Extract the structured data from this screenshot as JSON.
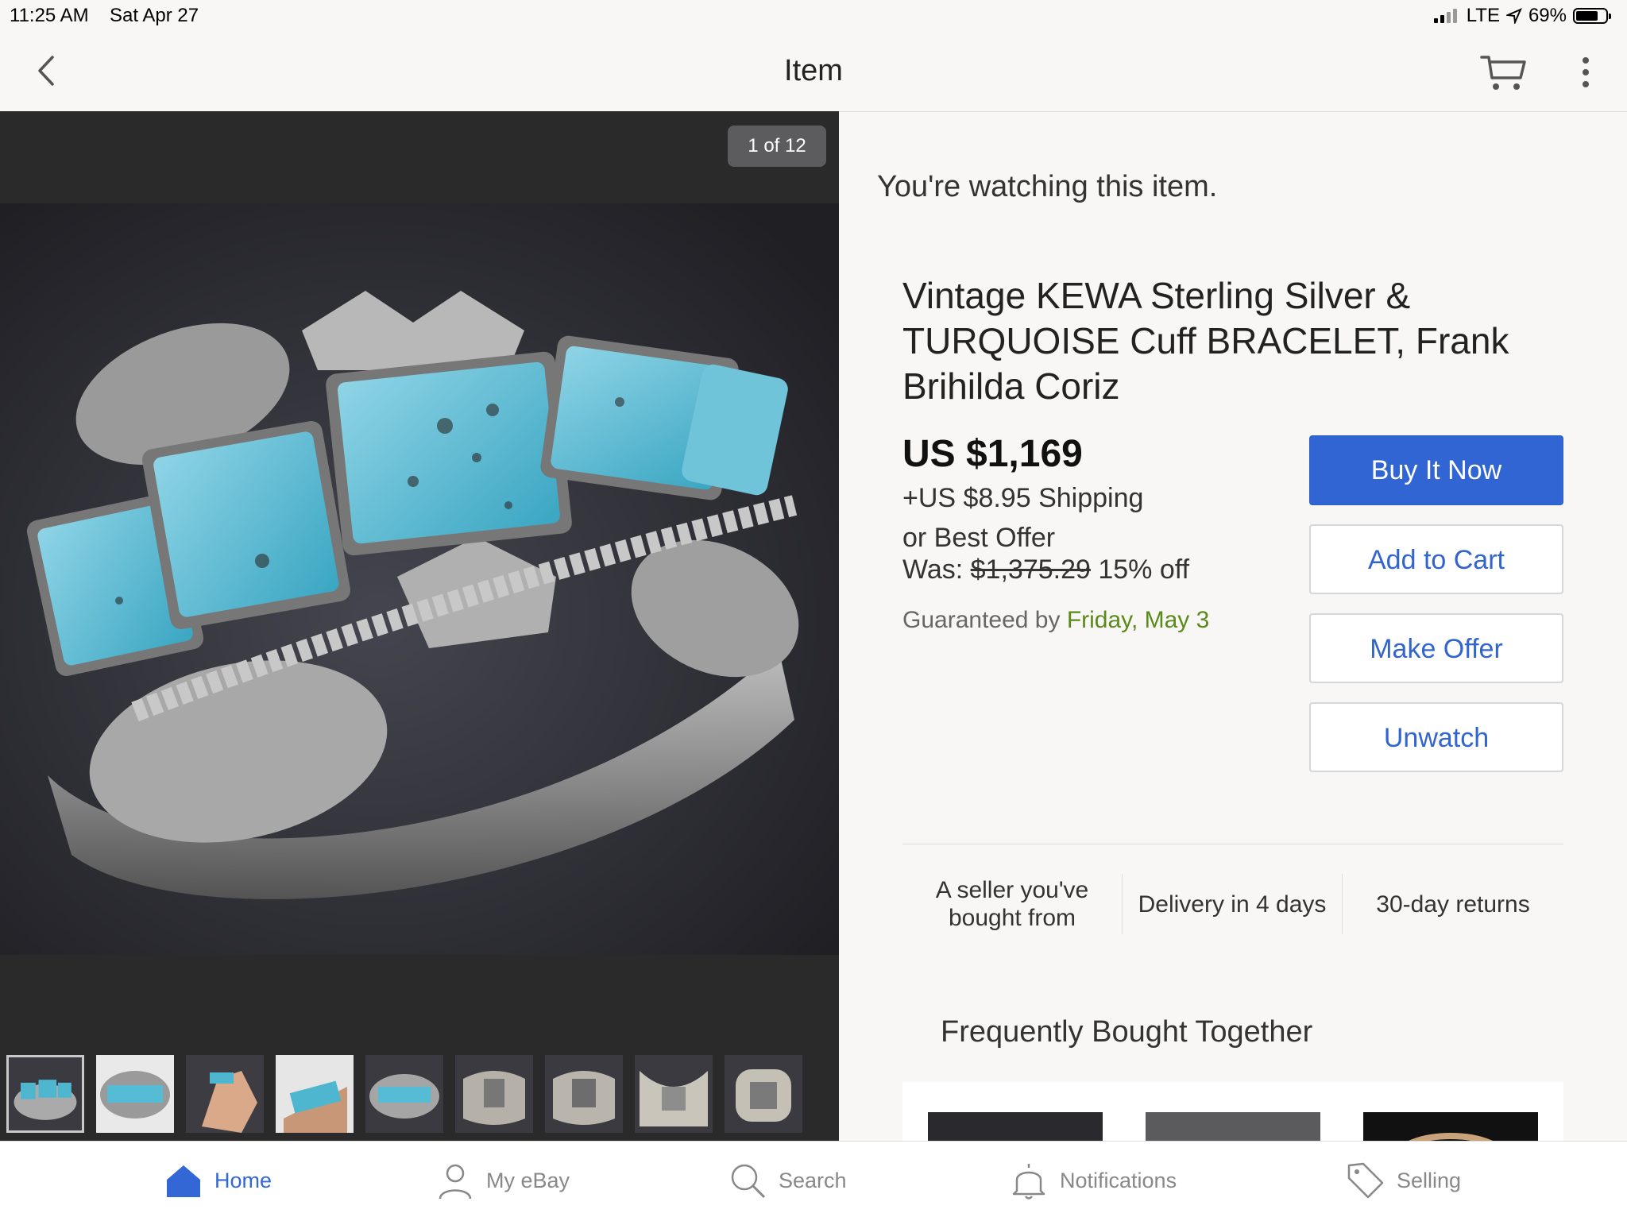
{
  "status_bar": {
    "time": "11:25 AM",
    "date": "Sat Apr 27",
    "network": "LTE",
    "battery": "69%"
  },
  "nav": {
    "title": "Item"
  },
  "gallery": {
    "counter": "1 of 12",
    "thumbnail_count": 9,
    "selected_index": 0
  },
  "item": {
    "watching_text": "You're watching this item.",
    "title": "Vintage KEWA Sterling Silver & TURQUOISE Cuff BRACELET, Frank Brihilda Coriz",
    "price": "US $1,169",
    "shipping": "+US $8.95 Shipping",
    "best_offer": "or Best Offer",
    "was_label": "Was:",
    "was_price": "$1,375.29",
    "discount": "15% off",
    "guaranteed_label": "Guaranteed by",
    "guaranteed_date": "Friday, May 3"
  },
  "actions": {
    "buy_now": "Buy It Now",
    "add_to_cart": "Add to Cart",
    "make_offer": "Make Offer",
    "unwatch": "Unwatch"
  },
  "features": {
    "seller": "A seller you've bought from",
    "delivery": "Delivery in 4 days",
    "returns": "30-day returns"
  },
  "fbt": {
    "title": "Frequently Bought Together"
  },
  "tabs": {
    "home": "Home",
    "my_ebay": "My eBay",
    "search": "Search",
    "notifications": "Notifications",
    "selling": "Selling"
  },
  "colors": {
    "accent": "#3165d4",
    "link": "#3164cf",
    "delivery_date": "#5a8a1a"
  }
}
